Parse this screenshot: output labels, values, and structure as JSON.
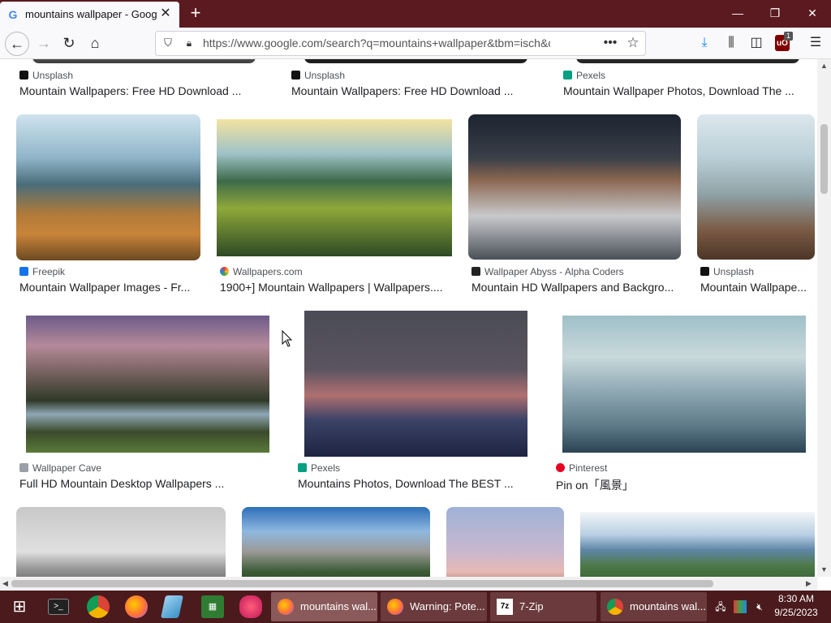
{
  "browser": {
    "tab_title": "mountains wallpaper - Google",
    "new_tab": "+",
    "url": "https://www.google.com/search?q=mountains+wallpaper&tbm=isch&chips=q",
    "more_dots": "•••",
    "ublock_badge": "1"
  },
  "row0": [
    {
      "source": "Unsplash",
      "caption": "Mountain Wallpapers: Free HD Download ..."
    },
    {
      "source": "Unsplash",
      "caption": "Mountain Wallpapers: Free HD Download ..."
    },
    {
      "source": "Pexels",
      "caption": "Mountain Wallpaper Photos, Download The ..."
    }
  ],
  "row1": [
    {
      "source": "Freepik",
      "caption": "Mountain Wallpaper Images - Fr..."
    },
    {
      "source": "Wallpapers.com",
      "caption": "1900+] Mountain Wallpapers | Wallpapers...."
    },
    {
      "source": "Wallpaper Abyss - Alpha Coders",
      "caption": "Mountain HD Wallpapers and Backgro..."
    },
    {
      "source": "Unsplash",
      "caption": "Mountain Wallpape..."
    }
  ],
  "row2": [
    {
      "source": "Wallpaper Cave",
      "caption": "Full HD Mountain Desktop Wallpapers ..."
    },
    {
      "source": "Pexels",
      "caption": "Mountains Photos, Download The BEST ..."
    },
    {
      "source": "Pinterest",
      "caption": "Pin on「風景」"
    }
  ],
  "taskbar": {
    "tasks": [
      {
        "label": "mountains wal..."
      },
      {
        "label": "Warning: Pote..."
      },
      {
        "label": "7-Zip"
      },
      {
        "label": "mountains wal..."
      }
    ],
    "time": "8:30 AM",
    "date": "9/25/2023"
  },
  "colors": {
    "titlebar": "#5a1a1f",
    "taskbar": "#4a1a1c"
  }
}
